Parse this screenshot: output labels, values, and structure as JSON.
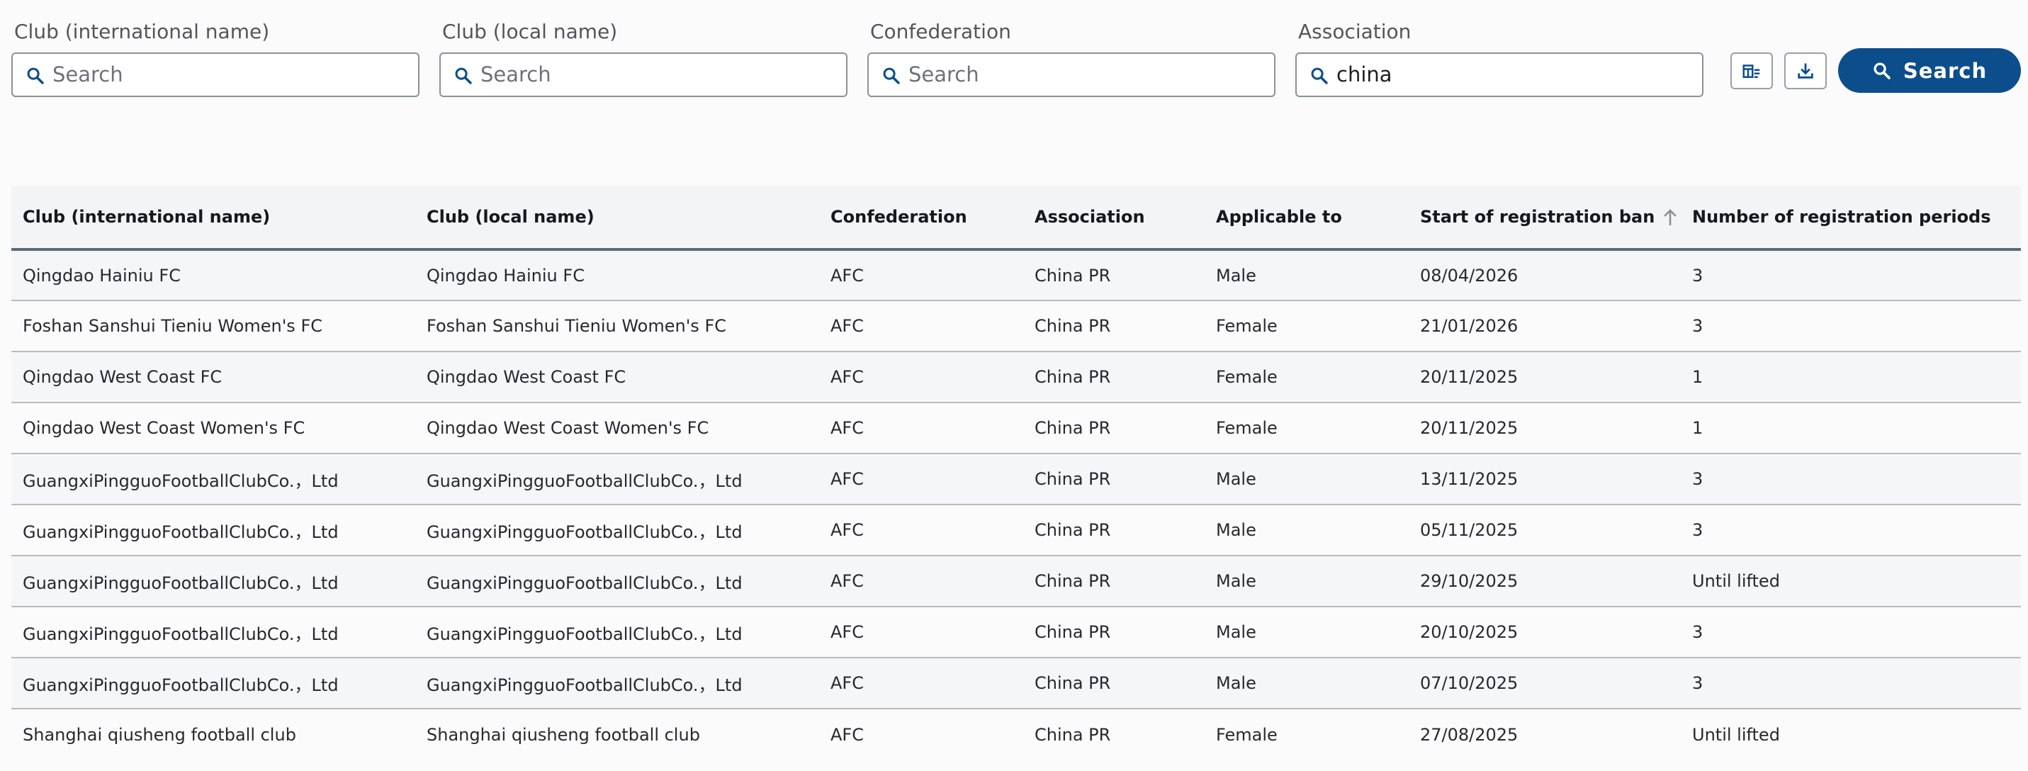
{
  "filters": [
    {
      "label": "Club (international name)",
      "placeholder": "Search",
      "value": ""
    },
    {
      "label": "Club (local name)",
      "placeholder": "Search",
      "value": ""
    },
    {
      "label": "Confederation",
      "placeholder": "Search",
      "value": ""
    },
    {
      "label": "Association",
      "placeholder": "Search",
      "value": "china"
    }
  ],
  "toolbar": {
    "clear_icon": "clear-filters-icon",
    "download_icon": "download-icon",
    "search_label": "Search"
  },
  "table": {
    "columns": [
      "Club (international name)",
      "Club (local name)",
      "Confederation",
      "Association",
      "Applicable to",
      "Start of registration ban",
      "Number of registration periods"
    ],
    "sorted_column": "Start of registration ban",
    "rows": [
      [
        "Qingdao Hainiu FC",
        "Qingdao Hainiu FC",
        "AFC",
        "China PR",
        "Male",
        "08/04/2026",
        "3"
      ],
      [
        "Foshan Sanshui Tieniu Women's FC",
        "Foshan Sanshui Tieniu Women's FC",
        "AFC",
        "China PR",
        "Female",
        "21/01/2026",
        "3"
      ],
      [
        "Qingdao West Coast FC",
        "Qingdao West Coast FC",
        "AFC",
        "China PR",
        "Female",
        "20/11/2025",
        "1"
      ],
      [
        "Qingdao West Coast Women's FC",
        "Qingdao West Coast Women's FC",
        "AFC",
        "China PR",
        "Female",
        "20/11/2025",
        "1"
      ],
      [
        "GuangxiPingguoFootballClubCo.，Ltd",
        "GuangxiPingguoFootballClubCo.，Ltd",
        "AFC",
        "China PR",
        "Male",
        "13/11/2025",
        "3"
      ],
      [
        "GuangxiPingguoFootballClubCo.，Ltd",
        "GuangxiPingguoFootballClubCo.，Ltd",
        "AFC",
        "China PR",
        "Male",
        "05/11/2025",
        "3"
      ],
      [
        "GuangxiPingguoFootballClubCo.，Ltd",
        "GuangxiPingguoFootballClubCo.，Ltd",
        "AFC",
        "China PR",
        "Male",
        "29/10/2025",
        "Until lifted"
      ],
      [
        "GuangxiPingguoFootballClubCo.，Ltd",
        "GuangxiPingguoFootballClubCo.，Ltd",
        "AFC",
        "China PR",
        "Male",
        "20/10/2025",
        "3"
      ],
      [
        "GuangxiPingguoFootballClubCo.，Ltd",
        "GuangxiPingguoFootballClubCo.，Ltd",
        "AFC",
        "China PR",
        "Male",
        "07/10/2025",
        "3"
      ],
      [
        "Shanghai qiusheng football club",
        "Shanghai qiusheng football club",
        "AFC",
        "China PR",
        "Female",
        "27/08/2025",
        "Until lifted"
      ]
    ]
  },
  "colors": {
    "accent": "#0c4e8c",
    "header_rule": "#5f6a78",
    "row_rule": "#b8bcc1"
  }
}
